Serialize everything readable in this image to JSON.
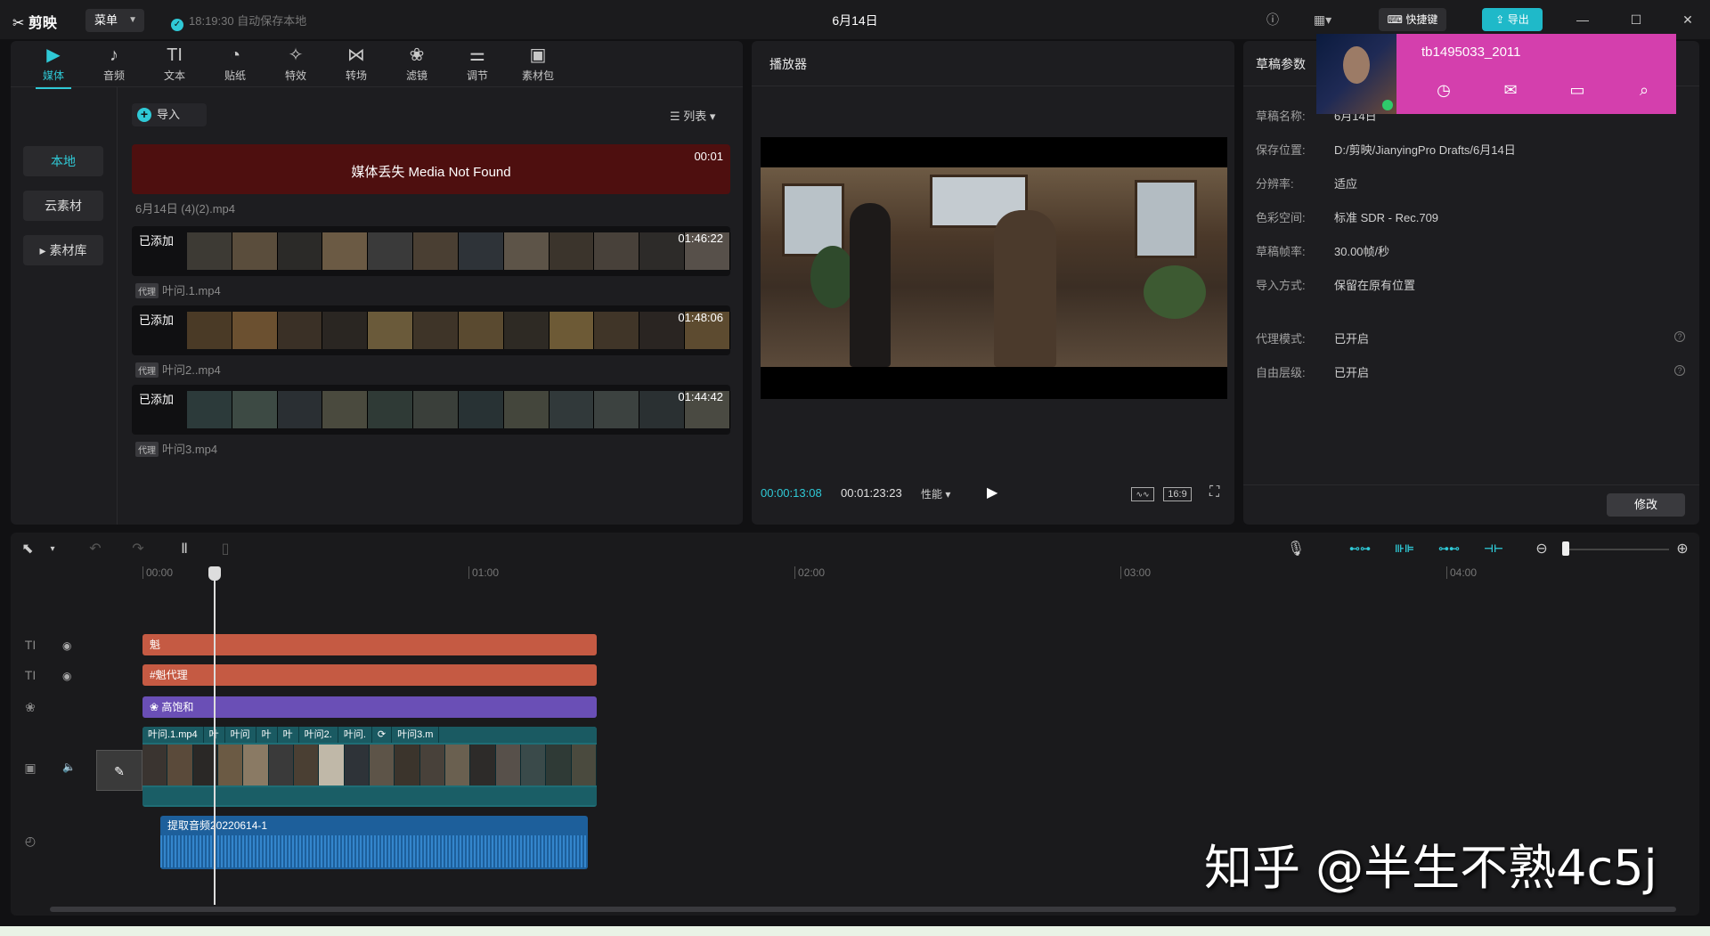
{
  "app": {
    "logo": "剪映",
    "menu_label": "菜单",
    "autosave": "18:19:30 自动保存本地",
    "title": "6月14日",
    "shortcut_label": "快捷键",
    "export_label": "导出"
  },
  "toolbar": {
    "tools": [
      {
        "label": "媒体",
        "icon": "media-icon",
        "glyph": "▶"
      },
      {
        "label": "音频",
        "icon": "audio-icon",
        "glyph": "♪"
      },
      {
        "label": "文本",
        "icon": "text-icon",
        "glyph": "TI"
      },
      {
        "label": "贴纸",
        "icon": "sticker-icon",
        "glyph": "◔"
      },
      {
        "label": "特效",
        "icon": "effects-icon",
        "glyph": "✧"
      },
      {
        "label": "转场",
        "icon": "transition-icon",
        "glyph": "⋈"
      },
      {
        "label": "滤镜",
        "icon": "filter-icon",
        "glyph": "❀"
      },
      {
        "label": "调节",
        "icon": "adjust-icon",
        "glyph": "⚌"
      },
      {
        "label": "素材包",
        "icon": "package-icon",
        "glyph": "▣"
      }
    ]
  },
  "sidebar": {
    "items": [
      {
        "label": "本地"
      },
      {
        "label": "云素材"
      },
      {
        "label": "▸ 素材库"
      }
    ]
  },
  "media": {
    "import_label": "导入",
    "view_label": "列表",
    "missing": {
      "text": "媒体丢失 Media Not Found",
      "duration": "00:01",
      "filename": "6月14日 (4)(2).mp4"
    },
    "clips": [
      {
        "status": "已添加",
        "duration": "01:46:22",
        "proxy": "代理",
        "filename": "叶问.1.mp4"
      },
      {
        "status": "已添加",
        "duration": "01:48:06",
        "proxy": "代理",
        "filename": "叶问2..mp4"
      },
      {
        "status": "已添加",
        "duration": "01:44:42",
        "proxy": "代理",
        "filename": "叶问3.mp4"
      }
    ]
  },
  "player": {
    "title": "播放器",
    "current_time": "00:00:13:08",
    "total_time": "00:01:23:23",
    "perf_label": "性能 ▾",
    "ratio_label": "16:9"
  },
  "params": {
    "title": "草稿参数",
    "rows": [
      {
        "key": "草稿名称:",
        "value": "6月14日"
      },
      {
        "key": "保存位置:",
        "value": "D:/剪映/JianyingPro Drafts/6月14日"
      },
      {
        "key": "分辨率:",
        "value": "适应"
      },
      {
        "key": "色彩空间:",
        "value": "标准 SDR - Rec.709"
      },
      {
        "key": "草稿帧率:",
        "value": "30.00帧/秒"
      },
      {
        "key": "导入方式:",
        "value": "保留在原有位置"
      },
      {
        "key": "代理模式:",
        "value": "已开启"
      },
      {
        "key": "自由层级:",
        "value": "已开启"
      }
    ],
    "modify_label": "修改"
  },
  "user_popup": {
    "username": "tb1495033_2011",
    "icons": [
      "clock-icon",
      "mail-icon",
      "calendar-icon",
      "search-icon"
    ]
  },
  "timeline": {
    "ruler": [
      "00:00",
      "01:00",
      "02:00",
      "03:00",
      "04:00"
    ],
    "text_clip_1": "魁",
    "text_clip_2": "#魁代理",
    "filter_clip": "高饱和",
    "main_clip_labels": [
      "叶问.1.mp4",
      "叶",
      "叶问",
      "叶",
      "叶",
      "叶问2.",
      "叶问.",
      "⟳",
      "叶问3.m"
    ],
    "audio_clip": "提取音频20220614-1"
  },
  "watermark": "知乎 @半生不熟4c5j",
  "colors": {
    "accent": "#2fc9d6",
    "missing_bg": "#4e0f0f",
    "text_clip": "#c55a43",
    "filter_clip": "#6a4fb6",
    "main_track": "#1f6d75",
    "audio_clip": "#1d5f9b",
    "popup_bg": "#d43fad"
  }
}
